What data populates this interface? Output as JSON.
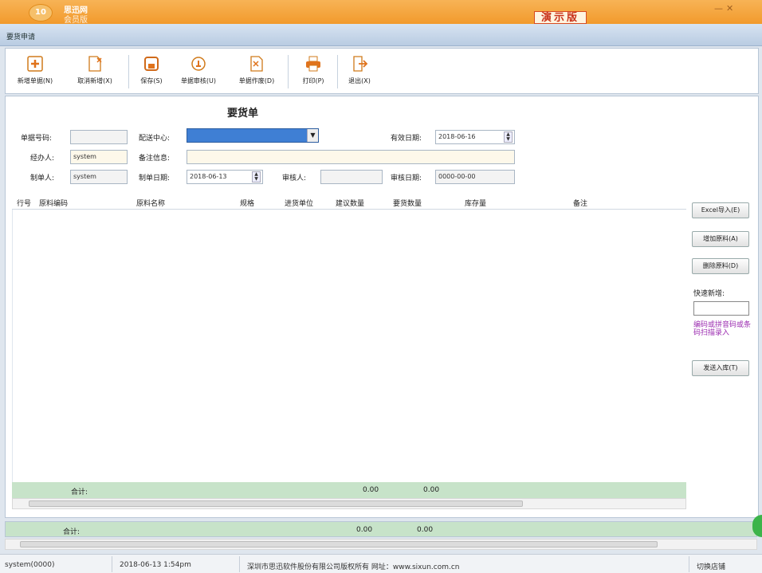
{
  "app": {
    "logo_text": "10",
    "title": "思迅网",
    "subtitle": "会员版",
    "demo_badge": "演示版",
    "window_controls": "✕ — ✕"
  },
  "window": {
    "title": "要货申请"
  },
  "toolbar": {
    "new": "新增单据(N)",
    "cancel": "取消新增(X)",
    "save": "保存(S)",
    "audit": "单据审核(U)",
    "void": "单据作废(D)",
    "print": "打印(P)",
    "exit": "退出(X)"
  },
  "form": {
    "title": "要货单",
    "doc_no_label": "单据号码:",
    "doc_no": "",
    "dist_center_label": "配送中心:",
    "dist_center": "",
    "valid_date_label": "有效日期:",
    "valid_date": "2018-06-16",
    "handler_label": "经办人:",
    "handler": "system",
    "remark_label": "备注信息:",
    "remark": "",
    "maker_label": "制单人:",
    "maker": "system",
    "make_date_label": "制单日期:",
    "make_date": "2018-06-13",
    "auditor_label": "审核人:",
    "auditor": "",
    "audit_date_label": "审核日期:",
    "audit_date": "0000-00-00"
  },
  "grid": {
    "columns": [
      "行号",
      "原料编码",
      "原料名称",
      "规格",
      "进货单位",
      "建议数量",
      "要货数量",
      "库存量",
      "备注"
    ],
    "rows": [],
    "sum_label": "合计:",
    "sum_suggest": "0.00",
    "sum_order": "0.00"
  },
  "side": {
    "excel_import": "Excel导入(E)",
    "add_material": "增加原料(A)",
    "delete_material": "删除原料(D)",
    "quick_add_label": "快速新增:",
    "quick_note": "编码或拼音码或条码扫描录入",
    "send_stock": "发送入库(T)"
  },
  "footer_total": {
    "label": "合计:",
    "v1": "0.00",
    "v2": "0.00"
  },
  "status": {
    "user": "system(0000)",
    "time": "2018-06-13 1:54pm",
    "copyright": "深圳市思迅软件股份有限公司版权所有 网址：www.sixun.com.cn",
    "switch_store": "切换店铺"
  }
}
